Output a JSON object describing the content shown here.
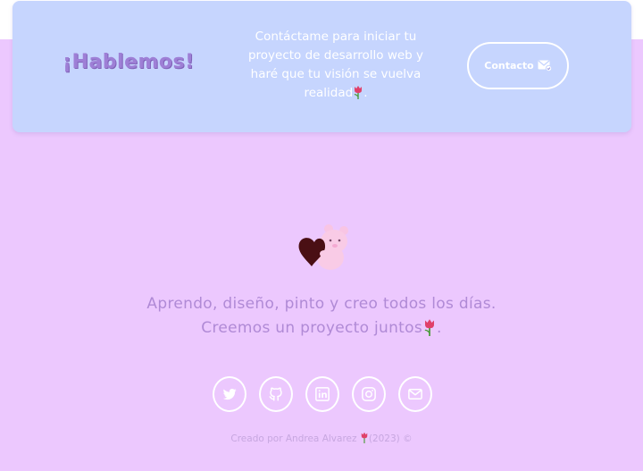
{
  "cta": {
    "title": "¡Hablemos!",
    "text": "Contáctame para iniciar tu proyecto de desarrollo web y haré que tu visión se vuelva realidad",
    "text_end": ".",
    "button_label": "Contacto",
    "button_icon": "mail-send-icon"
  },
  "footer": {
    "tagline_line1": "Aprendo, diseño, pinto y creo todos los días.",
    "tagline_line2": "Creemos un proyecto juntos",
    "tagline_end": ".",
    "credit_text": "Creado por Andrea Alvarez",
    "credit_year": "(2023) ©"
  },
  "socials": [
    {
      "name": "twitter",
      "icon": "twitter-icon"
    },
    {
      "name": "github",
      "icon": "github-icon"
    },
    {
      "name": "linkedin",
      "icon": "linkedin-icon"
    },
    {
      "name": "instagram",
      "icon": "instagram-icon"
    },
    {
      "name": "email",
      "icon": "mail-icon"
    }
  ],
  "colors": {
    "background": "#ecc8fe",
    "cta_background": "#c6d5fe",
    "text_purple": "#b08ad6",
    "title_purple": "#9e7fd6"
  }
}
